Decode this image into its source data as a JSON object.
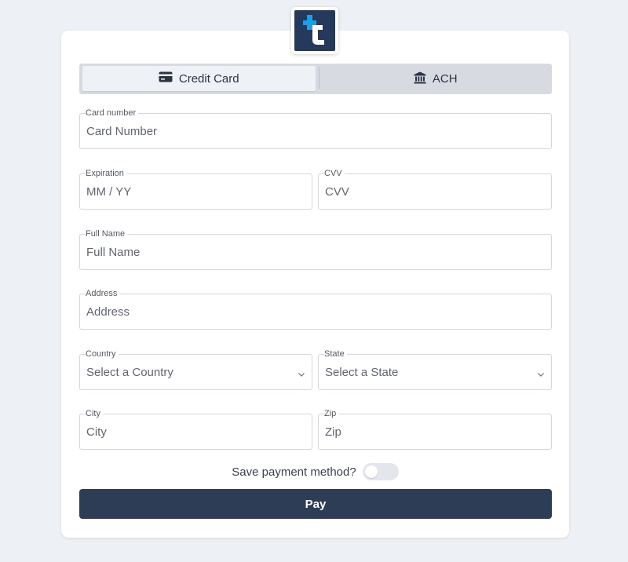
{
  "brand": {
    "logo_icon": "brand-t-icon",
    "colors": {
      "logo_bg": "#24395c",
      "logo_accent": "#1aa0ea"
    }
  },
  "tabs": [
    {
      "label": "Credit Card",
      "icon": "credit-card-icon",
      "active": true
    },
    {
      "label": "ACH",
      "icon": "bank-icon",
      "active": false
    }
  ],
  "fields": {
    "card_number": {
      "label": "Card number",
      "placeholder": "Card Number"
    },
    "expiration": {
      "label": "Expiration",
      "placeholder": "MM / YY"
    },
    "cvv": {
      "label": "CVV",
      "placeholder": "CVV"
    },
    "full_name": {
      "label": "Full Name",
      "placeholder": "Full Name"
    },
    "address": {
      "label": "Address",
      "placeholder": "Address"
    },
    "country": {
      "label": "Country",
      "value": "Select a Country"
    },
    "state": {
      "label": "State",
      "value": "Select a State"
    },
    "city": {
      "label": "City",
      "placeholder": "City"
    },
    "zip": {
      "label": "Zip",
      "placeholder": "Zip"
    }
  },
  "save_payment": {
    "label": "Save payment method?",
    "enabled": false
  },
  "pay_button": {
    "label": "Pay",
    "color": "#2d3d55"
  }
}
